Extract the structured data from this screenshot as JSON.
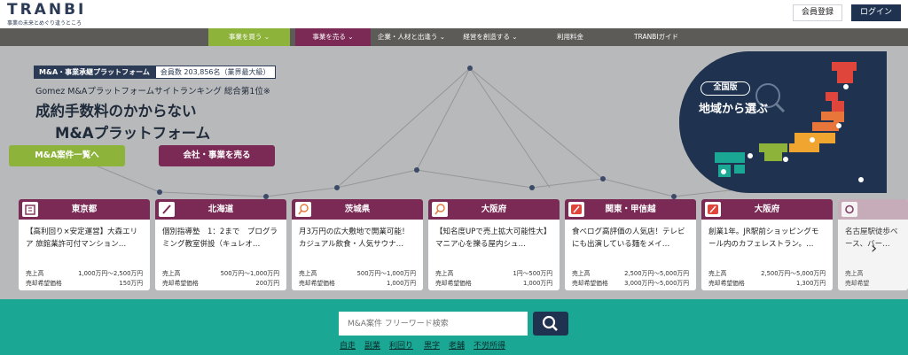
{
  "header": {
    "logo": "TRANBI",
    "tagline": "事業の未来とめぐり逢うところ",
    "register": "会員登録",
    "login": "ログイン"
  },
  "nav": [
    "事業を買う",
    "事業を売る",
    "企業・人材と出逢う",
    "経営を創造する",
    "利用料金",
    "TRANBIガイド"
  ],
  "hero": {
    "tag_main": "M&A・事業承継プラットフォーム",
    "tag_members": "会員数 203,856名（業界最大級）",
    "rank_line": "Gomez M&Aプラットフォームサイトランキング 総合第1位※",
    "title_line1": "成約手数料のかからない",
    "title_line2": "M&Aプラットフォーム",
    "cta_list": "M&A案件一覧へ",
    "cta_sell": "会社・事業を売る"
  },
  "map": {
    "badge": "全国版",
    "title": "地域から選ぶ"
  },
  "cards": [
    {
      "region": "東京都",
      "title": "【高利回り×安定運営】大森エリア 旅館業許可付マンション…",
      "sales_label": "売上高",
      "sales": "1,000万円～2,500万円",
      "price_label": "売却希望価格",
      "price": "150万円"
    },
    {
      "region": "北海道",
      "title": "個別指導塾　1：2まで　プログラミング教室併設（キュレオ…",
      "sales_label": "売上高",
      "sales": "500万円～1,000万円",
      "price_label": "売却希望価格",
      "price": "200万円"
    },
    {
      "region": "茨城県",
      "title": "月3万円の広大敷地で開業可能！カジュアル飲食・人気サウナ…",
      "sales_label": "売上高",
      "sales": "500万円～1,000万円",
      "price_label": "売却希望価格",
      "price": "1,000万円"
    },
    {
      "region": "大阪府",
      "title": "【知名度UPで売上拡大可能性大】マニア心を擽る屋内シュ…",
      "sales_label": "売上高",
      "sales": "1円～500万円",
      "price_label": "売却希望価格",
      "price": "1,000万円"
    },
    {
      "region": "関東・甲信越",
      "title": "食べログ高評価の人気店！テレビにも出演している麺をメイ…",
      "sales_label": "売上高",
      "sales": "2,500万円～5,000万円",
      "price_label": "売却希望価格",
      "price": "3,000万円～5,000万円"
    },
    {
      "region": "大阪府",
      "title": "創業1年。JR駅前ショッピングモール内のカフェレストラン。…",
      "sales_label": "売上高",
      "sales": "2,500万円～5,000万円",
      "price_label": "売却希望価格",
      "price": "1,300万円"
    },
    {
      "region": "",
      "title": "名古屋駅徒歩ベース、バー…",
      "sales_label": "売上高",
      "sales": "",
      "price_label": "売却希望",
      "price": ""
    }
  ],
  "search": {
    "placeholder": "M&A案件 フリーワード検索",
    "keywords": [
      "自走",
      "副業",
      "利回り",
      "黒字",
      "老舗",
      "不労所得"
    ]
  },
  "colors": {
    "navy": "#1f3350",
    "green": "#8db33a",
    "plum": "#7a2a55",
    "teal": "#1aa895"
  }
}
